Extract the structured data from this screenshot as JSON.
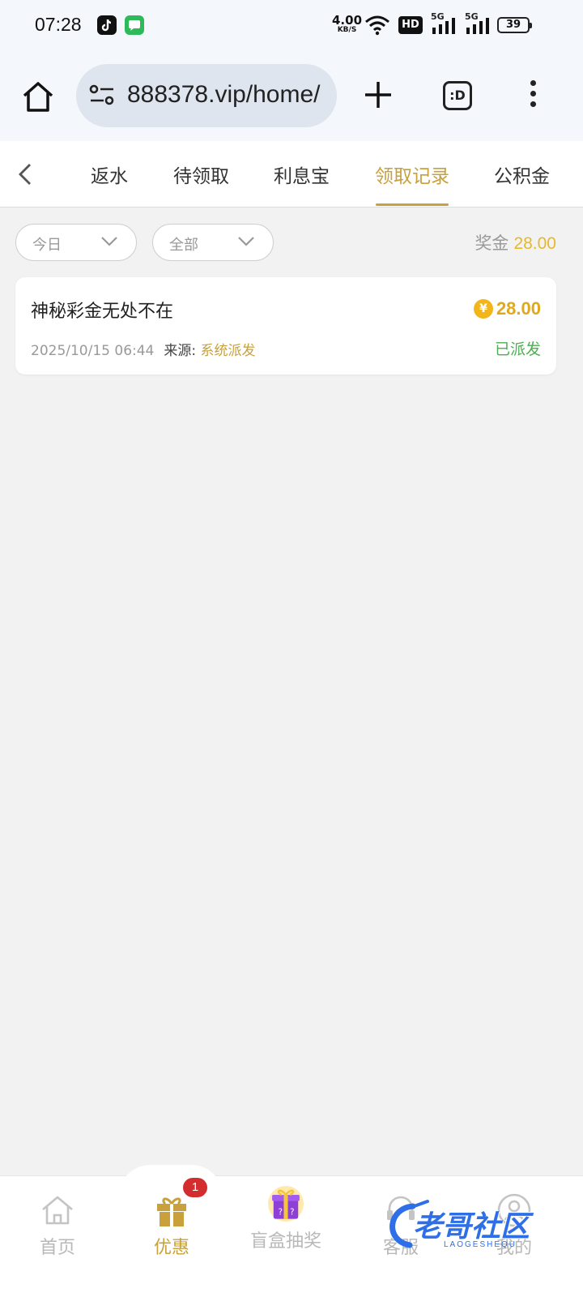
{
  "status_bar": {
    "time": "07:28",
    "net_speed": "4.00",
    "net_speed_unit": "KB/S",
    "hd_label": "HD",
    "signal1_label": "5G",
    "signal2_label": "5G",
    "battery": "39",
    "apps": [
      "tiktok-icon",
      "messages-icon"
    ]
  },
  "browser": {
    "url": "888378.vip/home/",
    "tab_count_label": ":D"
  },
  "tabs": [
    {
      "label": "返水",
      "active": false
    },
    {
      "label": "待领取",
      "active": false
    },
    {
      "label": "利息宝",
      "active": false
    },
    {
      "label": "领取记录",
      "active": true
    },
    {
      "label": "公积金",
      "active": false
    }
  ],
  "filters": {
    "date": "今日",
    "type": "全部"
  },
  "summary": {
    "label": "奖金",
    "amount": "28.00"
  },
  "records": [
    {
      "title": "神秘彩金无处不在",
      "amount": "28.00",
      "time": "2025/10/15 06:44",
      "source_label": "来源:",
      "source_value": "系统派发",
      "status": "已派发"
    }
  ],
  "bottom_nav": [
    {
      "label": "首页",
      "icon": "home-icon",
      "active": false
    },
    {
      "label": "优惠",
      "icon": "gift-icon",
      "active": true,
      "badge": "1"
    },
    {
      "label": "盲盒抽奖",
      "icon": "mystery-box-icon",
      "active": false
    },
    {
      "label": "客服",
      "icon": "customer-service-icon",
      "active": false
    },
    {
      "label": "我的",
      "icon": "profile-icon",
      "active": false
    }
  ],
  "watermark": {
    "text": "老哥社区",
    "sub": "LAOGESHEQU"
  },
  "colors": {
    "accent_gold": "#c8a13c",
    "amount_gold": "#e0a81d",
    "status_green": "#4caf50",
    "badge_red": "#d42d2d",
    "page_bg": "#f2f2f2"
  }
}
